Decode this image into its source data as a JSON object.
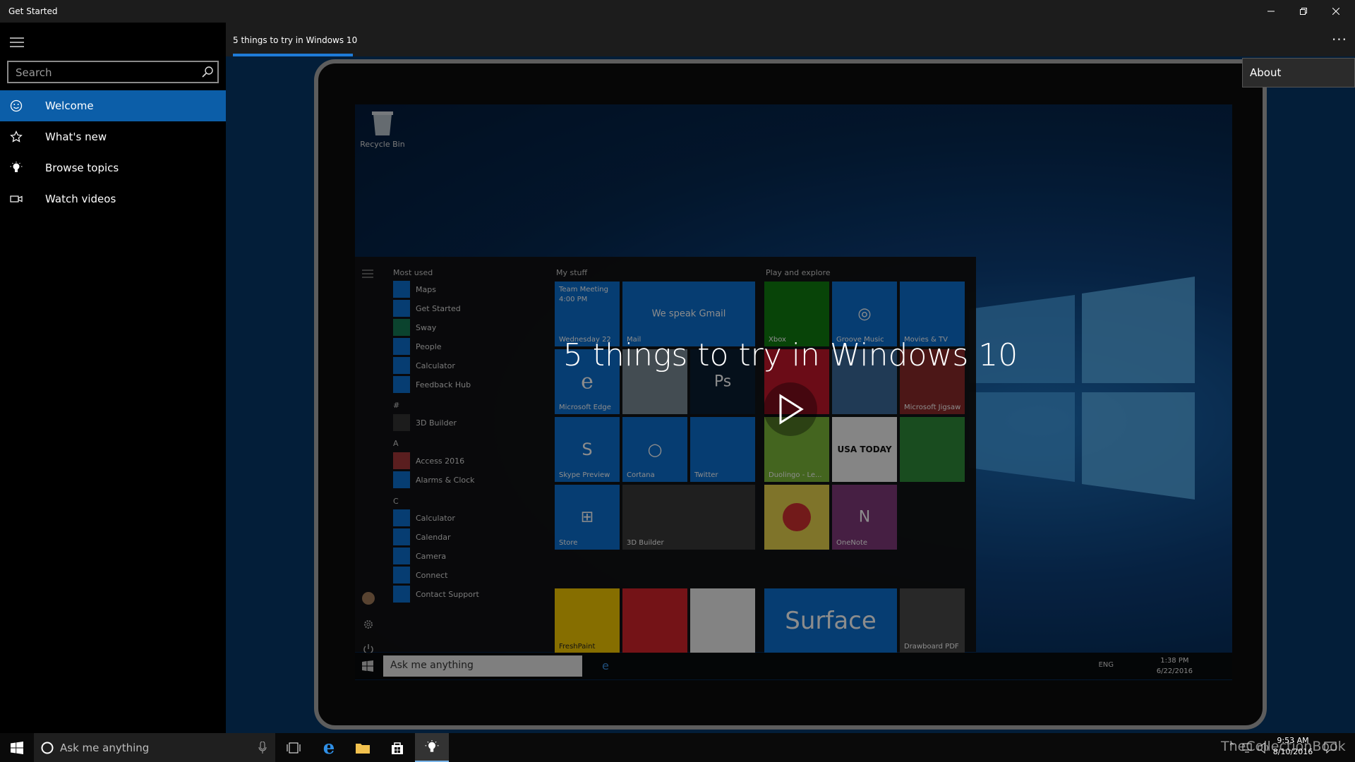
{
  "window": {
    "title": "Get Started"
  },
  "search": {
    "placeholder": "Search"
  },
  "nav": {
    "items": [
      {
        "label": "Welcome",
        "icon": "smiley-icon",
        "selected": true
      },
      {
        "label": "What's new",
        "icon": "star-icon"
      },
      {
        "label": "Browse topics",
        "icon": "lightbulb-icon"
      },
      {
        "label": "Watch videos",
        "icon": "video-icon"
      }
    ]
  },
  "tab": {
    "label": "5 things to try in Windows 10"
  },
  "menu": {
    "about": "About"
  },
  "video": {
    "title": "5 things to try in Windows 10"
  },
  "inner": {
    "recycle_bin": "Recycle Bin",
    "most_used": "Most used",
    "my_stuff": "My stuff",
    "play_explore": "Play and explore",
    "apps": [
      "Maps",
      "Get Started",
      "Sway",
      "People",
      "Calculator",
      "Feedback Hub"
    ],
    "section_hash": "#",
    "app_3d": "3D Builder",
    "section_a": "A",
    "apps_a": [
      "Access 2016",
      "Alarms & Clock"
    ],
    "section_c": "C",
    "apps_c": [
      "Calculator",
      "Calendar",
      "Camera",
      "Connect",
      "Contact Support"
    ],
    "tiles": {
      "team_meeting": "Team Meeting",
      "team_time": "4:00 PM",
      "wednesday": "Wednesday 22",
      "mail_text": "We speak Gmail",
      "mail": "Mail",
      "xbox": "Xbox",
      "groove": "Groove Music",
      "movies": "Movies & TV",
      "edge": "Microsoft Edge",
      "jigsaw": "Microsoft Jigsaw",
      "skype": "Skype Preview",
      "cortana": "Cortana",
      "twitter": "Twitter",
      "duolingo": "Duolingo - Le...",
      "usa": "USA TODAY",
      "store": "Store",
      "builder": "3D Builder",
      "onenote": "OneNote",
      "freshpaint": "FreshPaint",
      "surface": "Surface",
      "drawboard": "Drawboard PDF"
    },
    "ask": "Ask me anything",
    "lang": "ENG",
    "time": "1:38 PM",
    "date": "6/22/2016"
  },
  "taskbar": {
    "cortana": "Ask me anything",
    "time": "9:53 AM",
    "date": "8/10/2016",
    "watermark": "TheCollectionBook"
  }
}
